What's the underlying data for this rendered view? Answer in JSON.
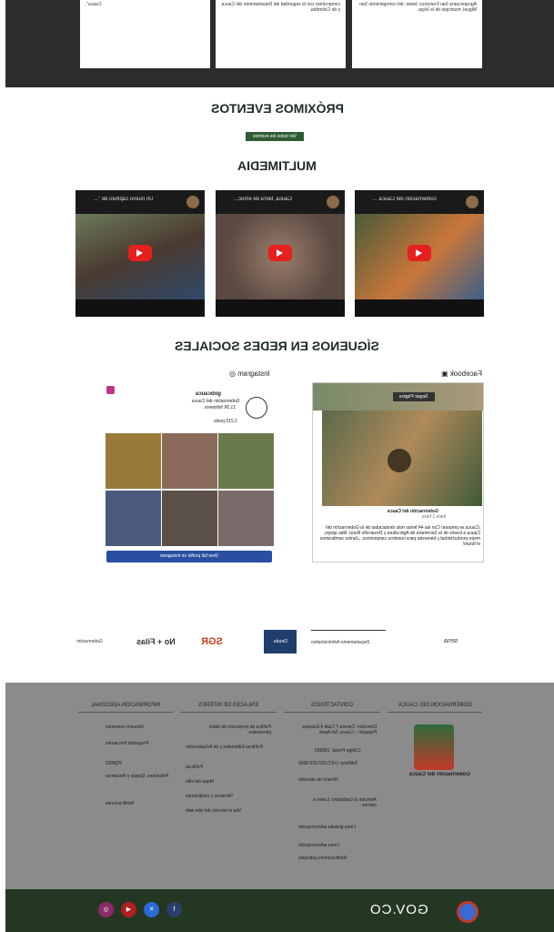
{
  "top_news": [
    {
      "text": "Agropecuaria San Francisco Javier, del corregimiento San Miguel, municipio de la Vega."
    },
    {
      "text": "compromiso con la seguridad del Departamento del Cauca y de Colombia."
    },
    {
      "text": "Cauca\"."
    }
  ],
  "events": {
    "title": "PRÓXIMOS EVENTOS",
    "button_label": "Ver todos los eventos"
  },
  "multimedia": {
    "title": "MULTIMEDIA",
    "videos": [
      {
        "title": "Gobernación del Cauca ..."
      },
      {
        "title": "Cauca, tierra de emoc..."
      },
      {
        "title": "Un nuevo capítulo de \"..."
      }
    ]
  },
  "social": {
    "title": "SÍGUENOS EN REDES SOCIALES",
    "facebook_label": "Facebook",
    "instagram_label": "Instagram",
    "facebook": {
      "page_name": "Gobernación del Cauca",
      "follow_label": "Seguir Página",
      "post_author": "Gobernación del Cauca",
      "post_time": "hace 1 hora",
      "post_text": "¡Cauca se prepara! Con las 44 ferias más destacadas de la Gobernación del Cauca a través de la Secretaría de Agricultura y Desarrollo Rural. Más apoyo, mejor productividad y bienestar para nuestros campesinos. ¡Juntos sembramos el futuro!"
    },
    "instagram": {
      "handle": "gobcauca",
      "name": "Gobernación del Cauca",
      "followers": "11.2K followers",
      "posts": "2,215 posts",
      "button_label": "View full profile on Instagram"
    }
  },
  "partners": [
    "sena",
    "Departamento Administrativo",
    "Deuda",
    "SGR",
    "No + Filas",
    "Gobernación"
  ],
  "footer": {
    "col1_title": "GOBERNACIÓN DEL CAUCA",
    "logo_text": "Gobernación del Cauca",
    "col2_title": "CONTÁCTENOS",
    "col2_items": [
      "Dirección: Carrera 7 Calle 4 Esquina, Popayán – Cauca, Sin Apart.",
      "Código Postal: 190003",
      "Teléfono: (+57) 602 820 9000",
      "Horario de atención",
      "Atención al ciudadano: Lunes a viernes",
      "Línea gratuita anticorrupción",
      "Línea anticorrupción",
      "Notificaciones judiciales"
    ],
    "col3_title": "ENLACES DE INTERÉS",
    "col3_items": [
      "Política de protección de datos personales",
      "Políticas Editoriales y de Actualización",
      "Políticas",
      "Mapa del sitio",
      "Términos y condiciones",
      "Vea el servicio del sitio web"
    ],
    "col4_title": "INFORMACIÓN ADICIONAL",
    "col4_items": [
      "Glosario normativo",
      "Preguntas frecuentes",
      "PQRSD",
      "Peticiones, Quejas y Reclamos",
      "Notificaciones"
    ]
  },
  "bottom": {
    "brand": "GOV.CO",
    "socials": [
      "facebook",
      "twitter",
      "youtube",
      "instagram"
    ]
  },
  "colors": {
    "dark_band": "#2b2e2c",
    "footer": "#8b8b8b",
    "bottom_bar": "#243722",
    "play": "#e61f1f",
    "ig_button": "#2a4fa1"
  }
}
